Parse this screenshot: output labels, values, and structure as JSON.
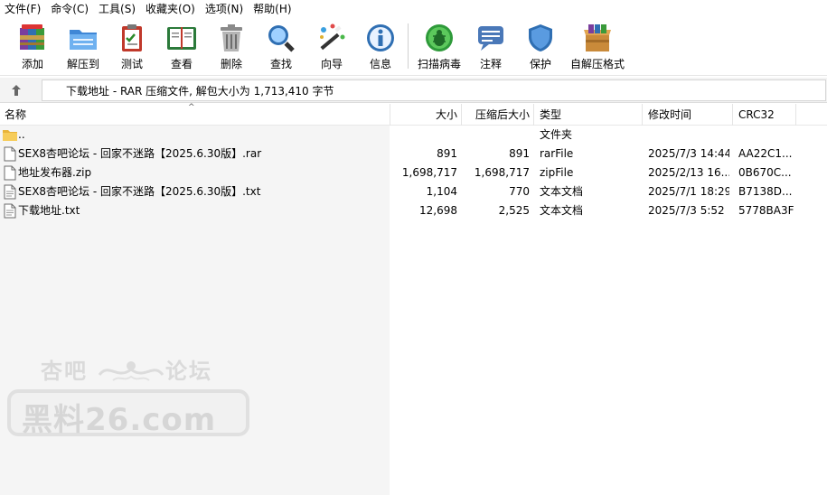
{
  "menu": [
    "文件(F)",
    "命令(C)",
    "工具(S)",
    "收藏夹(O)",
    "选项(N)",
    "帮助(H)"
  ],
  "toolbar": [
    {
      "label": "添加",
      "icon": "add-archive-icon"
    },
    {
      "label": "解压到",
      "icon": "extract-folder-icon"
    },
    {
      "label": "测试",
      "icon": "test-clipboard-icon"
    },
    {
      "label": "查看",
      "icon": "view-book-icon"
    },
    {
      "label": "删除",
      "icon": "trash-icon"
    },
    {
      "label": "查找",
      "icon": "magnifier-icon"
    },
    {
      "label": "向导",
      "icon": "wizard-wand-icon"
    },
    {
      "label": "信息",
      "icon": "info-icon"
    },
    {
      "label": "扫描病毒",
      "icon": "virus-scan-icon"
    },
    {
      "label": "注释",
      "icon": "comment-icon"
    },
    {
      "label": "保护",
      "icon": "shield-icon"
    },
    {
      "label": "自解压格式",
      "icon": "sfx-box-icon"
    }
  ],
  "address": {
    "text": "下载地址 - RAR 压缩文件, 解包大小为 1,713,410 字节"
  },
  "columns": {
    "name": "名称",
    "size": "大小",
    "packed": "压缩后大小",
    "type": "类型",
    "modified": "修改时间",
    "crc": "CRC32"
  },
  "rows": [
    {
      "name": "..",
      "size": "",
      "packed": "",
      "type": "文件夹",
      "modified": "",
      "crc": "",
      "icon": "folder-icon"
    },
    {
      "name": "SEX8杏吧论坛 - 回家不迷路【2025.6.30版】.rar",
      "size": "891",
      "packed": "891",
      "type": "rarFile",
      "modified": "2025/7/3 14:44",
      "crc": "AA22C1...",
      "icon": "file-icon"
    },
    {
      "name": "地址发布器.zip",
      "size": "1,698,717",
      "packed": "1,698,717",
      "type": "zipFile",
      "modified": "2025/2/13 16...",
      "crc": "0B670C...",
      "icon": "file-icon"
    },
    {
      "name": "SEX8杏吧论坛 - 回家不迷路【2025.6.30版】.txt",
      "size": "1,104",
      "packed": "770",
      "type": "文本文档",
      "modified": "2025/7/1 18:29",
      "crc": "B7138D...",
      "icon": "text-file-icon"
    },
    {
      "name": "下载地址.txt",
      "size": "12,698",
      "packed": "2,525",
      "type": "文本文档",
      "modified": "2025/7/3 5:52",
      "crc": "5778BA3F",
      "icon": "text-file-icon"
    }
  ],
  "watermark": {
    "top_left": "杏吧",
    "top_right": "论坛",
    "main": "黑料26.com"
  }
}
